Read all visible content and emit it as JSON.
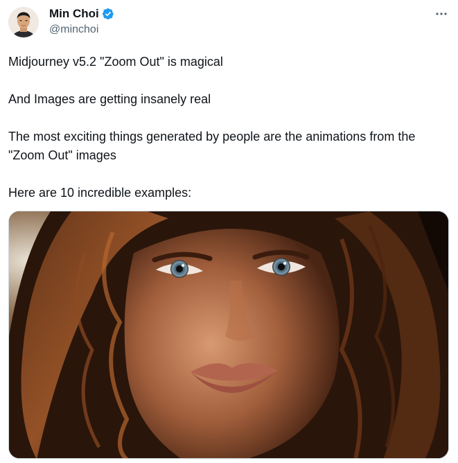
{
  "author": {
    "display_name": "Min Choi",
    "handle": "@minchoi",
    "verified": true,
    "avatar_icon": "avatar-photo"
  },
  "tweet": {
    "paragraphs": [
      "Midjourney v5.2 \"Zoom Out\" is magical",
      "And Images are getting insanely real",
      "The most exciting things generated by people are the animations from the \"Zoom Out\" images",
      "Here are 10 incredible examples:"
    ]
  },
  "media": {
    "kind": "image",
    "subject_icon": "portrait-photo"
  },
  "icons": {
    "more": "more-horizontal-icon",
    "verified": "verified-badge-icon"
  },
  "colors": {
    "text": "#0f1419",
    "secondary": "#536471",
    "verified": "#1d9bf0"
  }
}
